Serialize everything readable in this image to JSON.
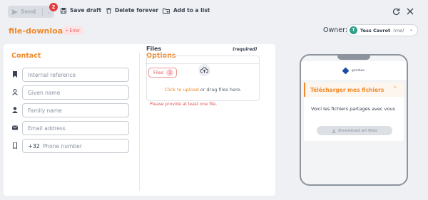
{
  "toolbar": {
    "send_label": "Send",
    "send_badge": "2",
    "save_draft_label": "Save draft",
    "delete_label": "Delete forever",
    "add_to_list_label": "Add to a list"
  },
  "header": {
    "title": "file-download",
    "status": "Error",
    "owner_label": "Owner:",
    "owner_initial": "T",
    "owner_name": "Tess Cavrot",
    "owner_me": "(me)"
  },
  "contact": {
    "title": "Contact",
    "fields": [
      {
        "icon": "bookmark-icon",
        "placeholder": "Internal reference"
      },
      {
        "icon": "user-outline-icon",
        "placeholder": "Given name"
      },
      {
        "icon": "user-solid-icon",
        "placeholder": "Family name"
      },
      {
        "icon": "mail-icon",
        "placeholder": "Email address"
      },
      {
        "icon": "phone-icon",
        "prefix": "+32",
        "placeholder": "Phone number"
      }
    ]
  },
  "options": {
    "title": "Options",
    "tab_label": "Files",
    "tab_count": "1",
    "files_label": "Files",
    "required": "(required)",
    "upload_link": "Click to upload",
    "upload_rest": " or drag files here.",
    "error": "Please provide at least one file."
  },
  "preview": {
    "brand": "gembox",
    "card_title": "Télécharger mes fichiers",
    "card_text": "Voici les fichiers partagés avec vous",
    "button_label": "Download all files"
  },
  "colors": {
    "accent": "#f08a2c",
    "error": "#e25555",
    "avatar": "#2f9e8a"
  }
}
